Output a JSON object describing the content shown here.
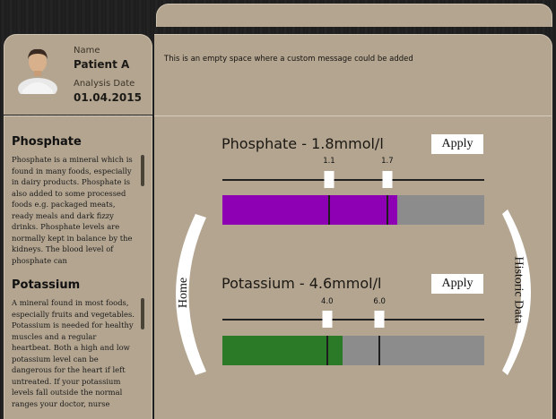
{
  "patient": {
    "name_label": "Name",
    "name": "Patient A",
    "date_label": "Analysis Date",
    "date": "01.04.2015"
  },
  "message": "This is an empty space where a custom message could be added",
  "sidebar": {
    "sections": [
      {
        "title": "Phosphate",
        "text": "Phosphate is a mineral which is found in many foods, especially in dairy products. Phosphate is also added to some processed foods e.g. packaged meats, ready meals and dark fizzy drinks. Phosphate levels are normally kept in balance by the kidneys. The blood level of phosphate can"
      },
      {
        "title": "Potassium",
        "text": "A mineral found in most foods, especially fruits and vegetables. Potassium is needed for healthy muscles and a regular heartbeat. Both a high and low potassium level can be dangerous for the heart if left untreated. If your potassium levels fall outside the normal ranges your doctor, nurse"
      }
    ]
  },
  "metrics": [
    {
      "title": "Phosphate - 1.8mmol/l",
      "apply_label": "Apply",
      "low_label": "1.1",
      "high_label": "1.7",
      "low": 1.1,
      "high": 1.7,
      "value": 1.8,
      "scale_max": 2.7,
      "fill_color": "#8d00b3"
    },
    {
      "title": "Potassium - 4.6mmol/l",
      "apply_label": "Apply",
      "low_label": "4.0",
      "high_label": "6.0",
      "low": 4.0,
      "high": 6.0,
      "value": 4.6,
      "scale_max": 10.0,
      "fill_color": "#2b7a27"
    }
  ],
  "nav": {
    "home_label": "Home",
    "historic_label": "Historic Data"
  },
  "colors": {
    "panel": "#b3a590",
    "track": "#8c8c8c"
  }
}
